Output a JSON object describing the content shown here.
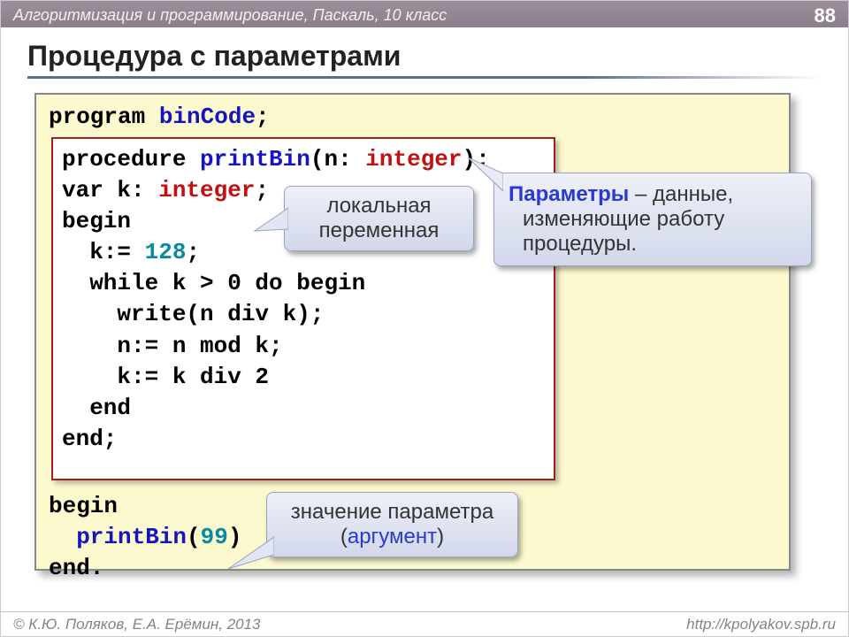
{
  "topbar": {
    "subject": "Алгоритмизация и программирование, Паскаль, 10 класс",
    "page": "88"
  },
  "title": "Процедура с параметрами",
  "outer_code": {
    "l1a": "program ",
    "l1b": "binCode",
    "l1c": ";",
    "l_begin": "begin",
    "l_call_a": "  printBin",
    "l_call_b": "(",
    "l_call_c": "99",
    "l_call_d": ")",
    "l_end": "end."
  },
  "inner_code": {
    "l1a": "procedure ",
    "l1b": "printBin",
    "l1c": "(n: ",
    "l1d": "integer",
    "l1e": ");",
    "l2a": "var k: ",
    "l2b": "integer",
    "l2c": ";",
    "l3": "begin",
    "l4a": "  k:= ",
    "l4b": "128",
    "l4c": ";",
    "l5": "  while k > 0 do begin",
    "l6": "    write(n div k);",
    "l7": "    n:= n mod k;",
    "l8": "    k:= k div 2",
    "l9": "  end",
    "l10": "end;"
  },
  "callouts": {
    "local": {
      "line1": "локальная",
      "line2": "переменная"
    },
    "params": {
      "line1a": "Параметры",
      "line1b": " – данные,",
      "line2": "изменяющие работу",
      "line3": "процедуры."
    },
    "arg": {
      "line1": "значение параметра",
      "line2a": "(",
      "line2b": "аргумент",
      "line2c": ")"
    }
  },
  "footer": {
    "left": "© К.Ю. Поляков, Е.А. Ерёмин, 2013",
    "right": "http://kpolyakov.spb.ru"
  }
}
